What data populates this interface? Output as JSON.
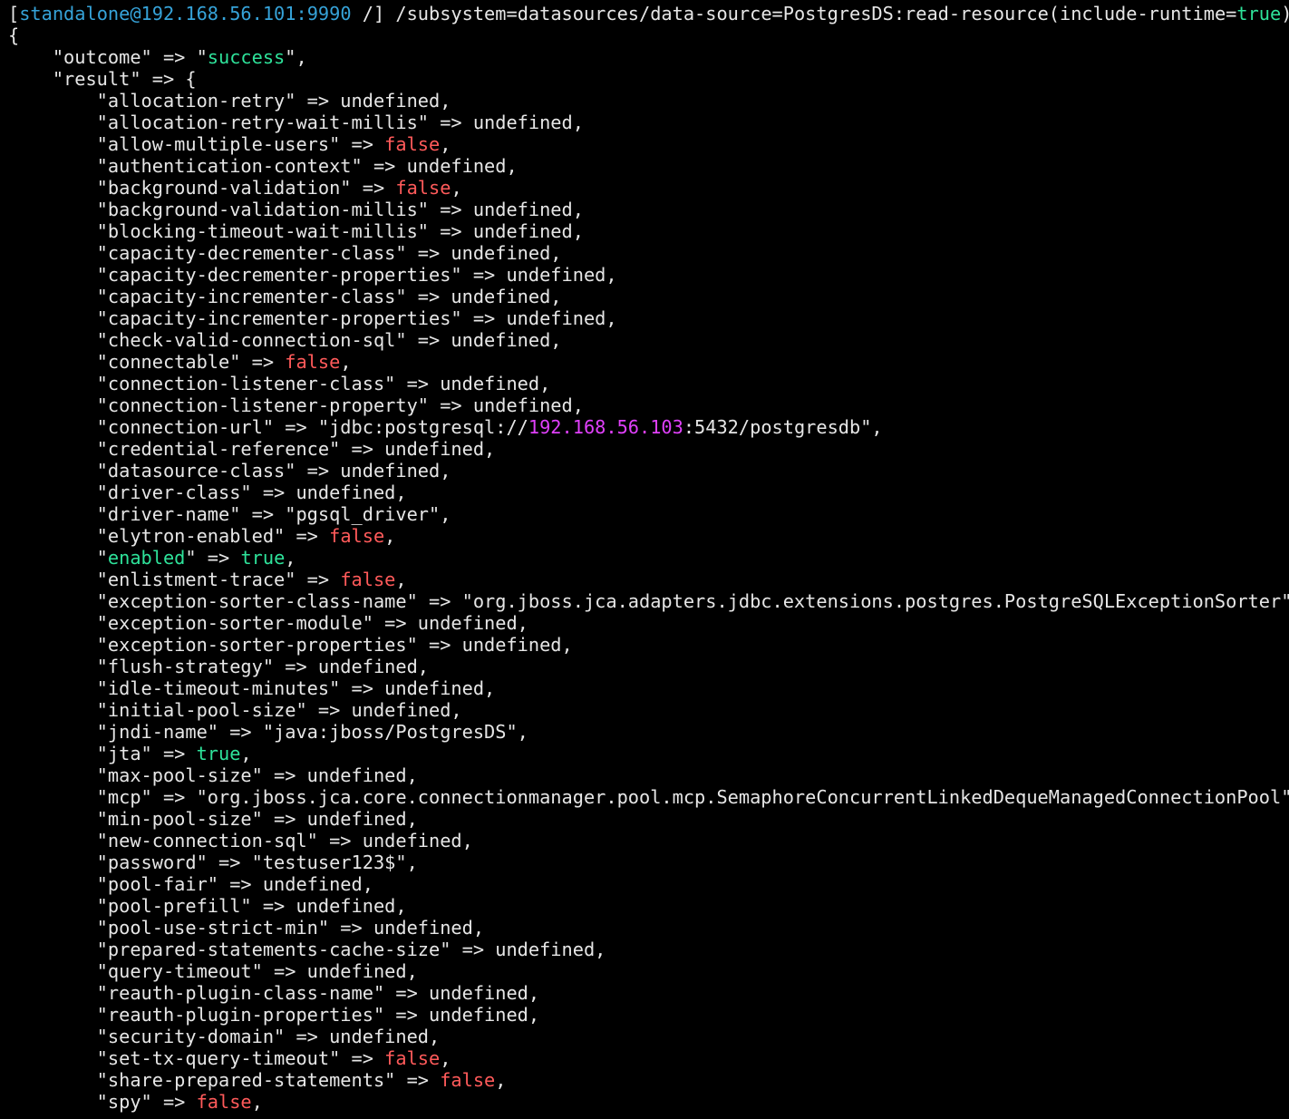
{
  "colors": {
    "background": "#000000",
    "default": "#e6e6e6",
    "blue": "#36a3d9",
    "green": "#2ee29a",
    "red": "#ff5a5a",
    "magenta": "#e040fb"
  },
  "prompt": {
    "open_bracket": "[",
    "user_host": "standalone@192.168.56.101:9990",
    "path_close": " /] ",
    "command_prefix": "/subsystem=datasources/data-source=PostgresDS:read-resource(include-runtime=",
    "command_value": "true",
    "command_suffix": ")"
  },
  "lines": [
    [
      {
        "t": "{",
        "c": "def"
      }
    ],
    [
      {
        "t": "    \"outcome\" => \"",
        "c": "def"
      },
      {
        "t": "success",
        "c": "green"
      },
      {
        "t": "\",",
        "c": "def"
      }
    ],
    [
      {
        "t": "    \"result\" => {",
        "c": "def"
      }
    ],
    [
      {
        "t": "        \"allocation-retry\" => undefined,",
        "c": "def"
      }
    ],
    [
      {
        "t": "        \"allocation-retry-wait-millis\" => undefined,",
        "c": "def"
      }
    ],
    [
      {
        "t": "        \"allow-multiple-users\" => ",
        "c": "def"
      },
      {
        "t": "false",
        "c": "red"
      },
      {
        "t": ",",
        "c": "def"
      }
    ],
    [
      {
        "t": "        \"authentication-context\" => undefined,",
        "c": "def"
      }
    ],
    [
      {
        "t": "        \"background-validation\" => ",
        "c": "def"
      },
      {
        "t": "false",
        "c": "red"
      },
      {
        "t": ",",
        "c": "def"
      }
    ],
    [
      {
        "t": "        \"background-validation-millis\" => undefined,",
        "c": "def"
      }
    ],
    [
      {
        "t": "        \"blocking-timeout-wait-millis\" => undefined,",
        "c": "def"
      }
    ],
    [
      {
        "t": "        \"capacity-decrementer-class\" => undefined,",
        "c": "def"
      }
    ],
    [
      {
        "t": "        \"capacity-decrementer-properties\" => undefined,",
        "c": "def"
      }
    ],
    [
      {
        "t": "        \"capacity-incrementer-class\" => undefined,",
        "c": "def"
      }
    ],
    [
      {
        "t": "        \"capacity-incrementer-properties\" => undefined,",
        "c": "def"
      }
    ],
    [
      {
        "t": "        \"check-valid-connection-sql\" => undefined,",
        "c": "def"
      }
    ],
    [
      {
        "t": "        \"connectable\" => ",
        "c": "def"
      },
      {
        "t": "false",
        "c": "red"
      },
      {
        "t": ",",
        "c": "def"
      }
    ],
    [
      {
        "t": "        \"connection-listener-class\" => undefined,",
        "c": "def"
      }
    ],
    [
      {
        "t": "        \"connection-listener-property\" => undefined,",
        "c": "def"
      }
    ],
    [
      {
        "t": "        \"connection-url\" => \"jdbc:postgresql://",
        "c": "def"
      },
      {
        "t": "192.168.56.103",
        "c": "mag"
      },
      {
        "t": ":5432/postgresdb\",",
        "c": "def"
      }
    ],
    [
      {
        "t": "        \"credential-reference\" => undefined,",
        "c": "def"
      }
    ],
    [
      {
        "t": "        \"datasource-class\" => undefined,",
        "c": "def"
      }
    ],
    [
      {
        "t": "        \"driver-class\" => undefined,",
        "c": "def"
      }
    ],
    [
      {
        "t": "        \"driver-name\" => \"pgsql_driver\",",
        "c": "def"
      }
    ],
    [
      {
        "t": "        \"elytron-enabled\" => ",
        "c": "def"
      },
      {
        "t": "false",
        "c": "red"
      },
      {
        "t": ",",
        "c": "def"
      }
    ],
    [
      {
        "t": "        \"",
        "c": "def"
      },
      {
        "t": "enabled",
        "c": "green"
      },
      {
        "t": "\" => ",
        "c": "def"
      },
      {
        "t": "true",
        "c": "green"
      },
      {
        "t": ",",
        "c": "def"
      }
    ],
    [
      {
        "t": "        \"enlistment-trace\" => ",
        "c": "def"
      },
      {
        "t": "false",
        "c": "red"
      },
      {
        "t": ",",
        "c": "def"
      }
    ],
    [
      {
        "t": "        \"exception-sorter-class-name\" => \"org.jboss.jca.adapters.jdbc.extensions.postgres.PostgreSQLExceptionSorter\",",
        "c": "def"
      }
    ],
    [
      {
        "t": "        \"exception-sorter-module\" => undefined,",
        "c": "def"
      }
    ],
    [
      {
        "t": "        \"exception-sorter-properties\" => undefined,",
        "c": "def"
      }
    ],
    [
      {
        "t": "        \"flush-strategy\" => undefined,",
        "c": "def"
      }
    ],
    [
      {
        "t": "        \"idle-timeout-minutes\" => undefined,",
        "c": "def"
      }
    ],
    [
      {
        "t": "        \"initial-pool-size\" => undefined,",
        "c": "def"
      }
    ],
    [
      {
        "t": "        \"jndi-name\" => \"java:jboss/PostgresDS\",",
        "c": "def"
      }
    ],
    [
      {
        "t": "        \"jta\" => ",
        "c": "def"
      },
      {
        "t": "true",
        "c": "green"
      },
      {
        "t": ",",
        "c": "def"
      }
    ],
    [
      {
        "t": "        \"max-pool-size\" => undefined,",
        "c": "def"
      }
    ],
    [
      {
        "t": "        \"mcp\" => \"org.jboss.jca.core.connectionmanager.pool.mcp.SemaphoreConcurrentLinkedDequeManagedConnectionPool\",",
        "c": "def"
      }
    ],
    [
      {
        "t": "        \"min-pool-size\" => undefined,",
        "c": "def"
      }
    ],
    [
      {
        "t": "        \"new-connection-sql\" => undefined,",
        "c": "def"
      }
    ],
    [
      {
        "t": "        \"password\" => \"testuser123$\",",
        "c": "def"
      }
    ],
    [
      {
        "t": "        \"pool-fair\" => undefined,",
        "c": "def"
      }
    ],
    [
      {
        "t": "        \"pool-prefill\" => undefined,",
        "c": "def"
      }
    ],
    [
      {
        "t": "        \"pool-use-strict-min\" => undefined,",
        "c": "def"
      }
    ],
    [
      {
        "t": "        \"prepared-statements-cache-size\" => undefined,",
        "c": "def"
      }
    ],
    [
      {
        "t": "        \"query-timeout\" => undefined,",
        "c": "def"
      }
    ],
    [
      {
        "t": "        \"reauth-plugin-class-name\" => undefined,",
        "c": "def"
      }
    ],
    [
      {
        "t": "        \"reauth-plugin-properties\" => undefined,",
        "c": "def"
      }
    ],
    [
      {
        "t": "        \"security-domain\" => undefined,",
        "c": "def"
      }
    ],
    [
      {
        "t": "        \"set-tx-query-timeout\" => ",
        "c": "def"
      },
      {
        "t": "false",
        "c": "red"
      },
      {
        "t": ",",
        "c": "def"
      }
    ],
    [
      {
        "t": "        \"share-prepared-statements\" => ",
        "c": "def"
      },
      {
        "t": "false",
        "c": "red"
      },
      {
        "t": ",",
        "c": "def"
      }
    ],
    [
      {
        "t": "        \"spy\" => ",
        "c": "def"
      },
      {
        "t": "false",
        "c": "red"
      },
      {
        "t": ",",
        "c": "def"
      }
    ]
  ]
}
